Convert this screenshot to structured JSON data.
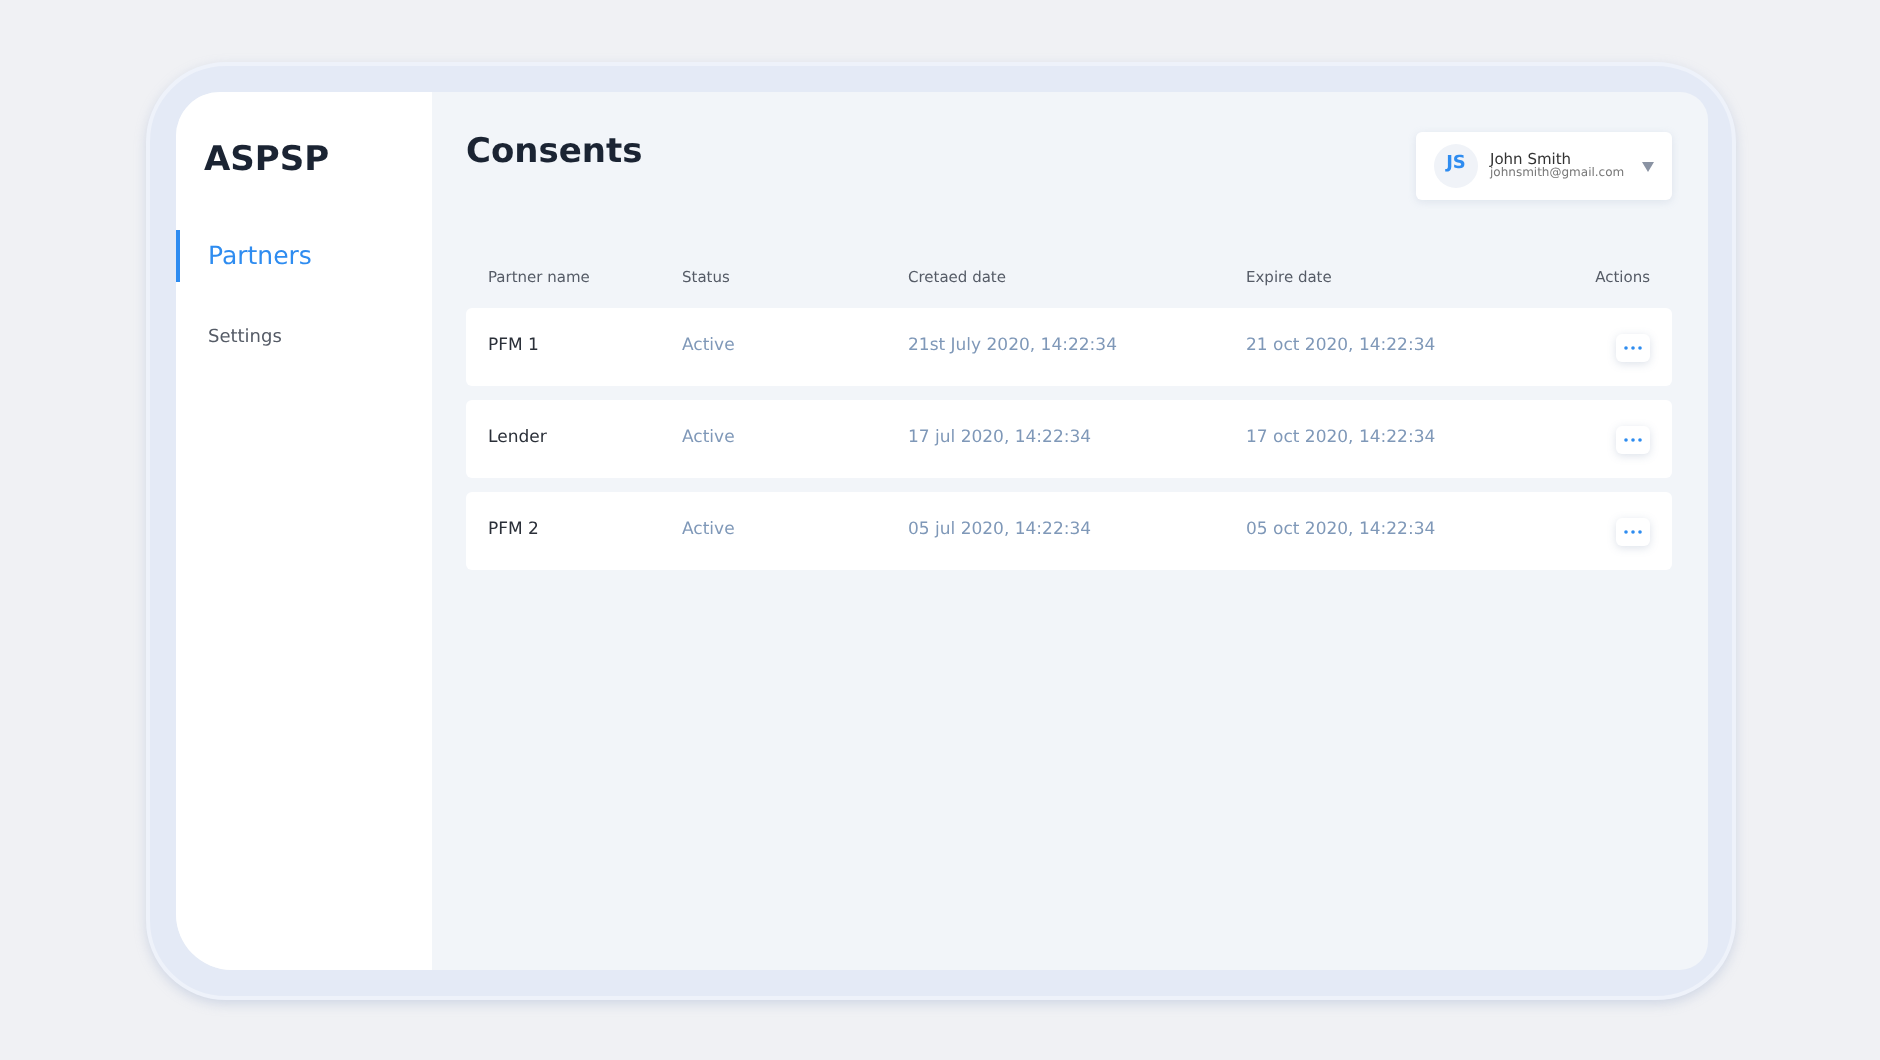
{
  "sidebar": {
    "brand": "ASPSP",
    "items": [
      {
        "label": "Partners",
        "selected": true
      },
      {
        "label": "Settings",
        "selected": false
      }
    ]
  },
  "page_title": "Consents",
  "user": {
    "initials": "JS",
    "name": "John Smith",
    "email": "johnsmith@gmail.com"
  },
  "table": {
    "columns": [
      "Partner name",
      "Status",
      "Cretaed date",
      "Expire date",
      "Actions"
    ],
    "rows": [
      {
        "partner": "PFM 1",
        "status": "Active",
        "created": "21st July 2020, 14:22:34",
        "expires": "21 oct 2020, 14:22:34"
      },
      {
        "partner": "Lender",
        "status": "Active",
        "created": "17 jul 2020, 14:22:34",
        "expires": "17 oct 2020, 14:22:34"
      },
      {
        "partner": "PFM 2",
        "status": "Active",
        "created": "05 jul 2020, 14:22:34",
        "expires": "05 oct 2020, 14:22:34"
      }
    ]
  }
}
